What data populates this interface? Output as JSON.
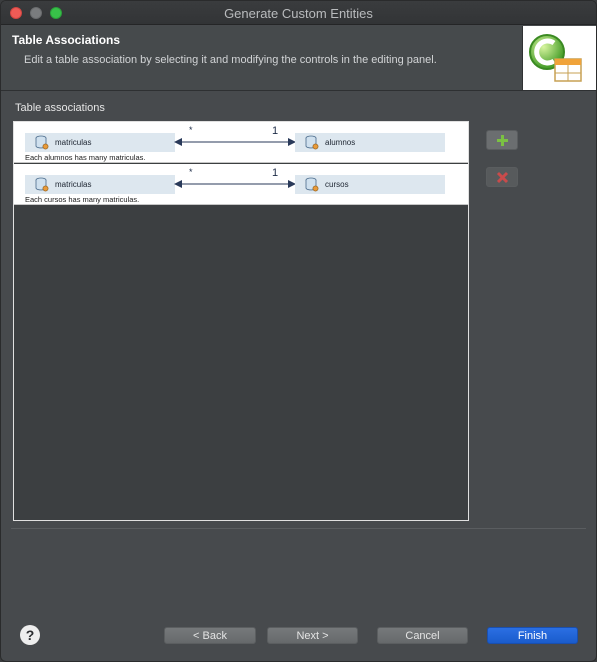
{
  "window": {
    "title": "Generate Custom Entities"
  },
  "header": {
    "title": "Table Associations",
    "description": "Edit a table association by selecting it and modifying the controls in the editing panel."
  },
  "section": {
    "label": "Table associations"
  },
  "associations": [
    {
      "left_table": "matriculas",
      "right_table": "alumnos",
      "left_cardinality": "*",
      "right_cardinality": "1",
      "description": "Each alumnos has many matriculas."
    },
    {
      "left_table": "matriculas",
      "right_table": "cursos",
      "left_cardinality": "*",
      "right_cardinality": "1",
      "description": "Each cursos has many matriculas."
    }
  ],
  "buttons": {
    "help": "?",
    "back": "< Back",
    "next": "Next >",
    "cancel": "Cancel",
    "finish": "Finish"
  },
  "icons": {
    "add": "add-icon",
    "remove": "remove-icon",
    "table": "database-table-icon",
    "logo": "wizard-logo-icon"
  },
  "colors": {
    "accent": "#1a5ccc",
    "add_icon": "#7bc143",
    "remove_icon": "#c94b4b"
  }
}
